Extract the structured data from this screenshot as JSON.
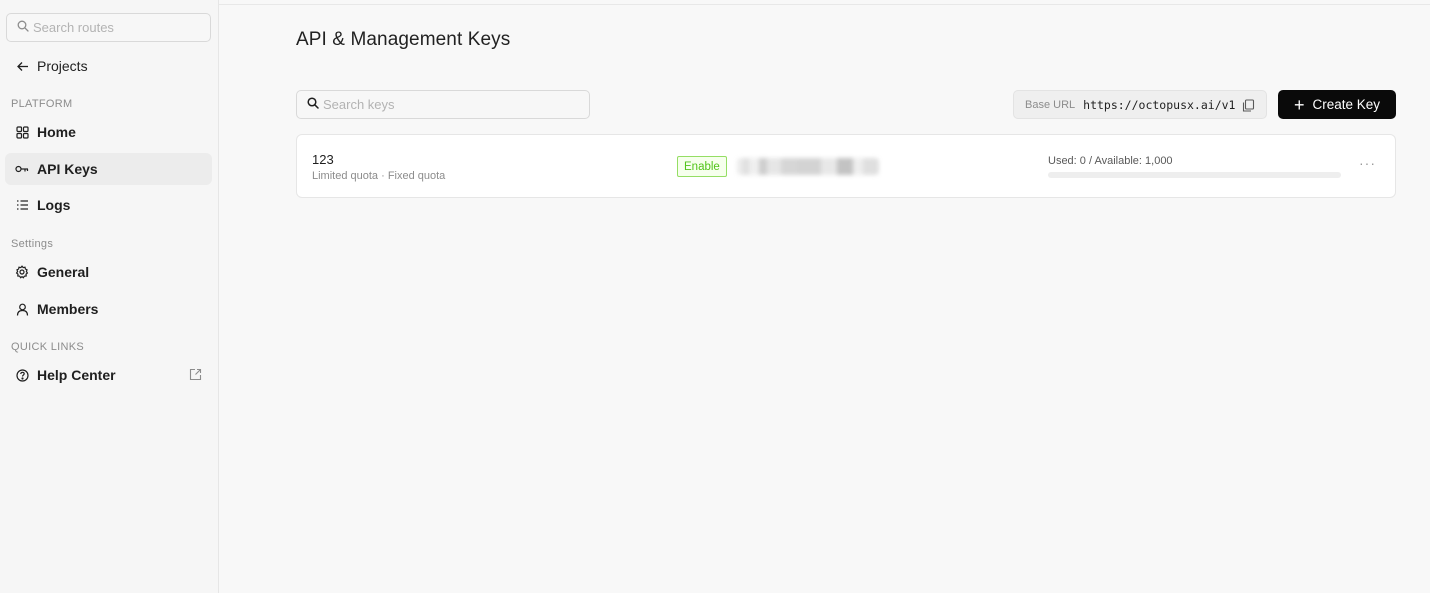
{
  "sidebar": {
    "search_placeholder": "Search routes",
    "back_label": "Projects",
    "sections": {
      "platform": "PLATFORM",
      "settings": "Settings",
      "quick_links": "QUICK LINKS"
    },
    "items": {
      "home": "Home",
      "api_keys": "API Keys",
      "logs": "Logs",
      "general": "General",
      "members": "Members",
      "help_center": "Help Center"
    },
    "active_item": "api_keys"
  },
  "main": {
    "title": "API & Management Keys",
    "search_placeholder": "Search keys",
    "base_url_label": "Base URL",
    "base_url": "https://octopusx.ai/v1",
    "create_button": "Create Key",
    "keys": [
      {
        "name": "123",
        "meta": "Limited quota · Fixed quota",
        "status": "Enable",
        "usage_text": "Used: 0 / Available: 1,000",
        "used": 0,
        "available": 1000,
        "more": "···"
      }
    ]
  },
  "colors": {
    "accent_button": "#0a0a0a",
    "status_green": "#52c41a",
    "active_nav_bg": "#ececec"
  },
  "icons": [
    "search-icon",
    "arrow-left-icon",
    "grid-icon",
    "key-icon",
    "list-icon",
    "gear-icon",
    "user-icon",
    "help-circle-icon",
    "external-link-icon",
    "copy-icon",
    "plus-icon",
    "more-icon"
  ]
}
